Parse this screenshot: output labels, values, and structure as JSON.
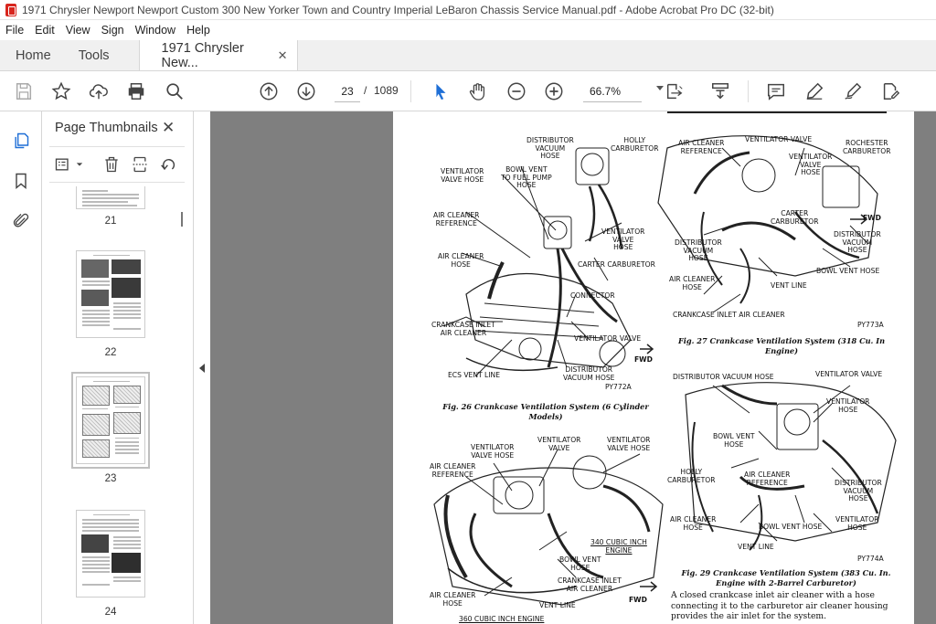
{
  "window": {
    "title": "1971 Chrysler Newport Newport Custom 300 New Yorker Town and Country Imperial LeBaron Chassis Service Manual.pdf - Adobe Acrobat Pro DC (32-bit)"
  },
  "menu": [
    "File",
    "Edit",
    "View",
    "Sign",
    "Window",
    "Help"
  ],
  "tabs": {
    "home": "Home",
    "tools": "Tools",
    "document": "1971 Chrysler New...",
    "close": "✕"
  },
  "toolbar": {
    "current_page": "23",
    "page_separator": "/",
    "total_pages": "1089",
    "zoom": "66.7%"
  },
  "thumbnails": {
    "title": "Page Thumbnails",
    "close": "✕",
    "pages": [
      {
        "label": "21"
      },
      {
        "label": "22"
      },
      {
        "label": "23",
        "selected": true
      },
      {
        "label": "24"
      }
    ]
  },
  "document": {
    "fig26": {
      "labels": {
        "distributor_vacuum_hose": "DISTRIBUTOR\nVACUUM\nHOSE",
        "holly_carburetor": "HOLLY\nCARBURETOR",
        "ventilator_valve_hose": "VENTILATOR\nVALVE HOSE",
        "bowl_vent": "BOWL VENT\nTO FUEL PUMP\nHOSE",
        "air_cleaner_reference": "AIR CLEANER\nREFERENCE",
        "ventilator_valve_hose_right": "VENTILATOR\nVALVE\nHOSE",
        "air_cleaner_hose": "AIR CLEANER\nHOSE",
        "carter_carburetor": "CARTER CARBURETOR",
        "connector": "CONNECTOR",
        "crankcase_inlet": "CRANKCASE INLET\nAIR CLEANER",
        "ventilator_valve": "VENTILATOR VALVE",
        "fwd": "FWD",
        "distributor_vacuum_hose_bottom": "DISTRIBUTOR\nVACUUM HOSE",
        "ecs_vent_line": "ECS VENT LINE",
        "code": "PY772A"
      },
      "caption": "Fig. 26 Crankcase Ventilation System (6 Cylinder\nModels)"
    },
    "fig27": {
      "labels": {
        "air_cleaner_reference": "AIR CLEANER\nREFERENCE",
        "ventilator_valve": "VENTILATOR VALVE",
        "ventilator_valve_hose": "VENTILATOR\nVALVE\nHOSE",
        "rochester_carburetor": "ROCHESTER\nCARBURETOR",
        "carter_carburetor": "CARTER\nCARBURETOR",
        "fwd": "FWD",
        "distributor_vacuum_hose_left": "DISTRIBUTOR\nVACUUM\nHOSE",
        "distributor_vacuum_hose_right": "DISTRIBUTOR\nVACUUM\nHOSE",
        "air_cleaner_hose": "AIR CLEANER\nHOSE",
        "vent_line": "VENT LINE",
        "bowl_vent_hose": "BOWL VENT HOSE",
        "crankcase_inlet": "CRANKCASE INLET AIR CLEANER",
        "code": "PY773A"
      },
      "caption": "Fig. 27 Crankcase Ventilation System (318 Cu. In\nEngine)"
    },
    "fig28": {
      "labels": {
        "ventilator_valve_hose": "VENTILATOR\nVALVE HOSE",
        "ventilator_valve": "VENTILATOR\nVALVE",
        "ventilator_valve_hose_right": "VENTILATOR\nVALVE HOSE",
        "air_cleaner_reference": "AIR CLEANER\nREFERENCE",
        "cubic_inch_340": "340 CUBIC INCH\nENGINE",
        "bowl_vent_hose": "BOWL VENT\nHOSE",
        "crankcase_inlet": "CRANKCASE INLET\nAIR CLEANER",
        "air_cleaner_hose": "AIR CLEANER\nHOSE",
        "vent_line": "VENT LINE",
        "fwd": "FWD",
        "cubic_inch_360": "360 CUBIC INCH ENGINE"
      }
    },
    "fig29": {
      "labels": {
        "distributor_vacuum_hose": "DISTRIBUTOR VACUUM HOSE",
        "ventilator_valve": "VENTILATOR VALVE",
        "ventilator_hose": "VENTILATOR\nHOSE",
        "bowl_vent_hose": "BOWL VENT\nHOSE",
        "holly_carburetor": "HOLLY\nCARBURETOR",
        "air_cleaner_reference": "AIR CLEANER\nREFERENCE",
        "distributor_vacuum_hose_right": "DISTRIBUTOR\nVACUUM\nHOSE",
        "air_cleaner_hose": "AIR CLEANER\nHOSE",
        "bowl_vent_hose_bottom": "BOWL VENT HOSE",
        "ventilator_hose_right": "VENTILATOR\nHOSE",
        "vent_line": "VENT LINE",
        "code": "PY774A"
      },
      "caption": "Fig. 29 Crankcase Ventilation System (383 Cu. In.\nEngine with 2-Barrel Carburetor)"
    },
    "paragraph": "A closed crankcase inlet air cleaner with a hose\nconnecting it to the carburetor air cleaner housing\nprovides the air inlet for the system."
  }
}
